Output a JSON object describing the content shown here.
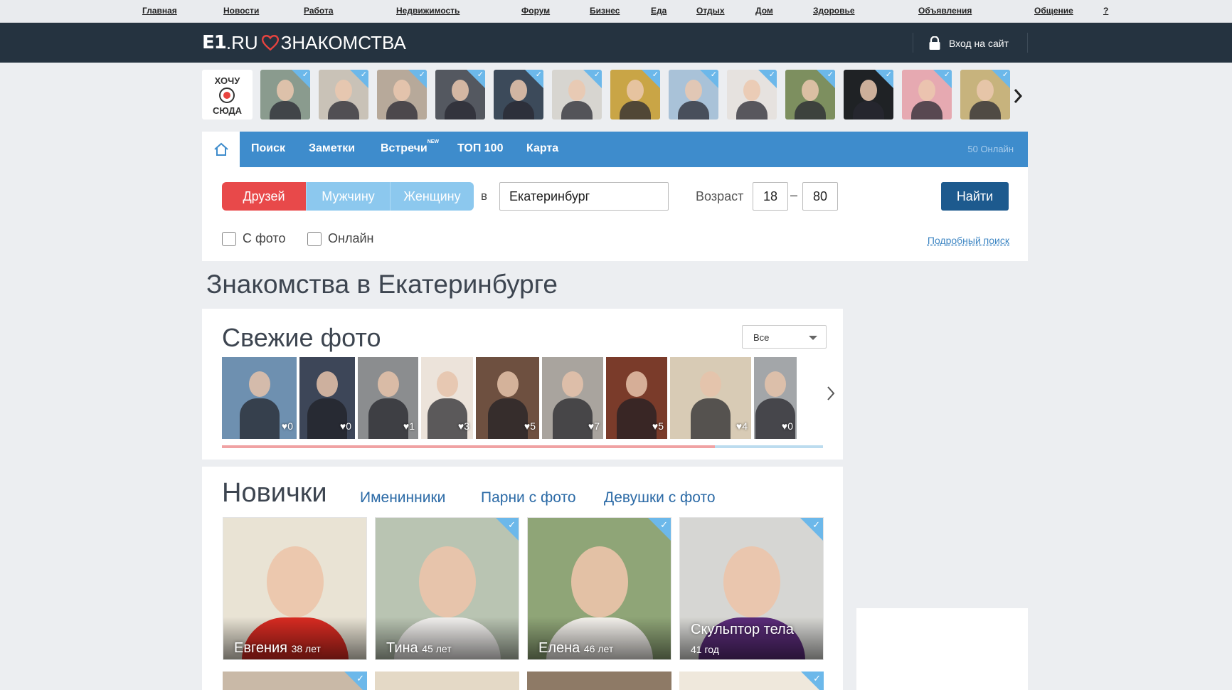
{
  "portal_nav": [
    "Главная",
    "Новости",
    "Работа",
    "Недвижимость",
    "Форум",
    "Бизнес",
    "Еда",
    "Отдых",
    "Дом",
    "Здоровье",
    "Объявления",
    "Общение",
    "?"
  ],
  "header": {
    "logo_e1": "E1",
    "logo_ru": ".RU",
    "logo_znakomstva": "ЗНАКОМСТВА",
    "login_label": "Вход на сайт",
    "heart_color": "#e8433f"
  },
  "strip": {
    "want_line1": "ХОЧУ",
    "want_line2": "СЮДА",
    "thumb_colors": [
      "#8a9b8e",
      "#c9c2b7",
      "#b7a99a",
      "#545860",
      "#3c4a5a",
      "#d7d5d0",
      "#c9a546",
      "#a9c2d8",
      "#e6e2df",
      "#7d8f5f",
      "#1f2225",
      "#e6a9b1",
      "#c7b37d"
    ]
  },
  "tabs": {
    "items": [
      "Поиск",
      "Заметки",
      "Встречи",
      "ТОП 100",
      "Карта"
    ],
    "new_badge": "NEW",
    "online": "50 Онлайн"
  },
  "search": {
    "who": [
      "Друзей",
      "Мужчину",
      "Женщину"
    ],
    "in_label": "в",
    "city": "Екатеринбург",
    "age_label": "Возраст",
    "age_from": "18",
    "age_dash": "–",
    "age_to": "80",
    "find_button": "Найти",
    "with_photo": "С фото",
    "online": "Онлайн",
    "advanced": "Подробный поиск"
  },
  "page_title": "Знакомства в Екатеринбурге",
  "fresh": {
    "title": "Свежие фото",
    "filter": "Все",
    "photos": [
      {
        "likes": "0",
        "bg": "#6e90b0"
      },
      {
        "likes": "0",
        "bg": "#3d4658"
      },
      {
        "likes": "1",
        "bg": "#8b8d8f"
      },
      {
        "likes": "3",
        "bg": "#ece3da"
      },
      {
        "likes": "5",
        "bg": "#6e5040"
      },
      {
        "likes": "7",
        "bg": "#a9a49e"
      },
      {
        "likes": "5",
        "bg": "#7a3b2a"
      },
      {
        "likes": "4",
        "bg": "#d8cbb5"
      },
      {
        "likes": "0",
        "bg": "#a3a6a9"
      }
    ],
    "progress": 0.82
  },
  "newbies": {
    "title": "Новички",
    "tabs": [
      "Именинники",
      "Парни с фото",
      "Девушки с фото"
    ],
    "profiles": [
      {
        "name": "Евгения",
        "age": "38 лет",
        "bg": "#e9e3d4",
        "body": "#d92b22",
        "verified": false
      },
      {
        "name": "Тина",
        "age": "45 лет",
        "bg": "#b9c4b2",
        "body": "#f2f0ee",
        "verified": true
      },
      {
        "name": "Елена",
        "age": "46 лет",
        "bg": "#8fa577",
        "body": "#f4f1ec",
        "verified": true
      },
      {
        "name": "Скульптор тела",
        "age": "41 год",
        "bg": "#d6d6d3",
        "body": "#5b2c7a",
        "verified": true
      }
    ]
  }
}
